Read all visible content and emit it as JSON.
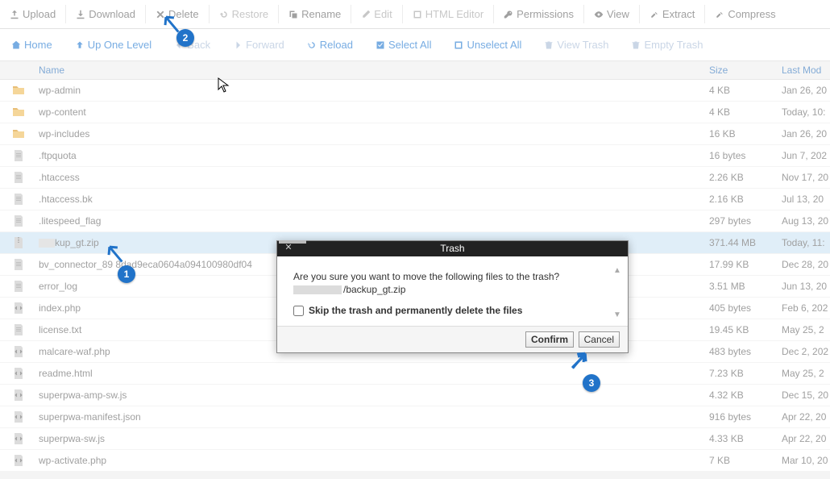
{
  "toolbar": {
    "upload": "Upload",
    "download": "Download",
    "delete": "Delete",
    "restore": "Restore",
    "rename": "Rename",
    "edit": "Edit",
    "html_editor": "HTML Editor",
    "permissions": "Permissions",
    "view": "View",
    "extract": "Extract",
    "compress": "Compress"
  },
  "nav": {
    "home": "Home",
    "up": "Up One Level",
    "back": "Back",
    "forward": "Forward",
    "reload": "Reload",
    "select_all": "Select All",
    "unselect_all": "Unselect All",
    "view_trash": "View Trash",
    "empty_trash": "Empty Trash"
  },
  "columns": {
    "name": "Name",
    "size": "Size",
    "modified": "Last Mod"
  },
  "files": [
    {
      "type": "folder",
      "name": "wp-admin",
      "size": "4 KB",
      "modified": "Jan 26, 20"
    },
    {
      "type": "folder",
      "name": "wp-content",
      "size": "4 KB",
      "modified": "Today, 10:"
    },
    {
      "type": "folder",
      "name": "wp-includes",
      "size": "16 KB",
      "modified": "Jan 26, 20"
    },
    {
      "type": "file",
      "name": ".ftpquota",
      "size": "16 bytes",
      "modified": "Jun 7, 202"
    },
    {
      "type": "file",
      "name": ".htaccess",
      "size": "2.26 KB",
      "modified": "Nov 17, 20"
    },
    {
      "type": "file",
      "name": ".htaccess.bk",
      "size": "2.16 KB",
      "modified": "Jul 13, 20"
    },
    {
      "type": "file",
      "name": ".litespeed_flag",
      "size": "297 bytes",
      "modified": "Aug 13, 20"
    },
    {
      "type": "zip",
      "name": "kup_gt.zip",
      "size": "371.44 MB",
      "modified": "Today, 11:",
      "selected": true,
      "redact": true
    },
    {
      "type": "file",
      "name": "bv_connector_89     8dad9eca0604a094100980df04",
      "size": "17.99 KB",
      "modified": "Dec 28, 20"
    },
    {
      "type": "file",
      "name": "error_log",
      "size": "3.51 MB",
      "modified": "Jun 13, 20"
    },
    {
      "type": "code",
      "name": "index.php",
      "size": "405 bytes",
      "modified": "Feb 6, 202"
    },
    {
      "type": "file",
      "name": "license.txt",
      "size": "19.45 KB",
      "modified": "May 25, 2"
    },
    {
      "type": "code",
      "name": "malcare-waf.php",
      "size": "483 bytes",
      "modified": "Dec 2, 202"
    },
    {
      "type": "code",
      "name": "readme.html",
      "size": "7.23 KB",
      "modified": "May 25, 2"
    },
    {
      "type": "code",
      "name": "superpwa-amp-sw.js",
      "size": "4.32 KB",
      "modified": "Dec 15, 20"
    },
    {
      "type": "code",
      "name": "superpwa-manifest.json",
      "size": "916 bytes",
      "modified": "Apr 22, 20"
    },
    {
      "type": "code",
      "name": "superpwa-sw.js",
      "size": "4.33 KB",
      "modified": "Apr 22, 20"
    },
    {
      "type": "code",
      "name": "wp-activate.php",
      "size": "7 KB",
      "modified": "Mar 10, 20"
    }
  ],
  "modal": {
    "title": "Trash",
    "message": "Are you sure you want to move the following files to the trash?",
    "file": "/backup_gt.zip",
    "skip_label": "Skip the trash and permanently delete the files",
    "confirm": "Confirm",
    "cancel": "Cancel"
  },
  "annotations": {
    "b1": "1",
    "b2": "2",
    "b3": "3"
  }
}
